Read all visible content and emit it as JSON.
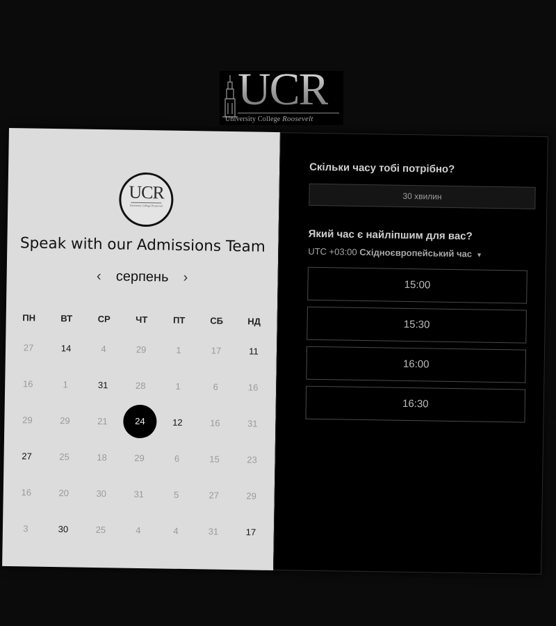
{
  "logo": {
    "mark": "UCR",
    "subtitle_main": "University College ",
    "subtitle_italic": "Roosevelt"
  },
  "left": {
    "circle_logo_mark": "UCR",
    "circle_logo_sub": "University College Roosevelt",
    "title": "Speak with our Admissions Team",
    "month": "серпень",
    "prev_arrow": "‹",
    "next_arrow": "›",
    "weekdays": [
      "ПН",
      "ВТ",
      "СР",
      "ЧТ",
      "ПТ",
      "СБ",
      "НД"
    ],
    "weeks": [
      [
        "27",
        "14",
        "4",
        "29",
        "1",
        "17",
        "11"
      ],
      [
        "16",
        "1",
        "31",
        "28",
        "1",
        "6",
        "16"
      ],
      [
        "29",
        "29",
        "21",
        "24",
        "12",
        "16",
        "31"
      ],
      [
        "27",
        "25",
        "18",
        "29",
        "6",
        "15",
        "23"
      ],
      [
        "16",
        "20",
        "30",
        "31",
        "5",
        "27",
        "29"
      ],
      [
        "3",
        "30",
        "25",
        "4",
        "4",
        "31",
        "17"
      ]
    ],
    "active_days": [
      [
        0,
        1
      ],
      [
        0,
        6
      ],
      [
        1,
        2
      ],
      [
        2,
        4
      ],
      [
        3,
        0
      ],
      [
        5,
        1
      ],
      [
        5,
        6
      ]
    ],
    "selected_day": [
      2,
      3
    ]
  },
  "right": {
    "duration_question": "Скільки часу тобі потрібно?",
    "duration_value": "30 хвилин",
    "time_question": "Який час є найліпшим для вас?",
    "timezone_offset": "UTC +03:00 ",
    "timezone_name": "Східноєвропейський час",
    "timezone_caret": "▼",
    "slots": [
      "15:00",
      "15:30",
      "16:00",
      "16:30"
    ]
  },
  "colors": {
    "left_panel_bg": "#dcdcdc",
    "right_panel_bg": "#000000",
    "selected_day_bg": "#000000"
  }
}
